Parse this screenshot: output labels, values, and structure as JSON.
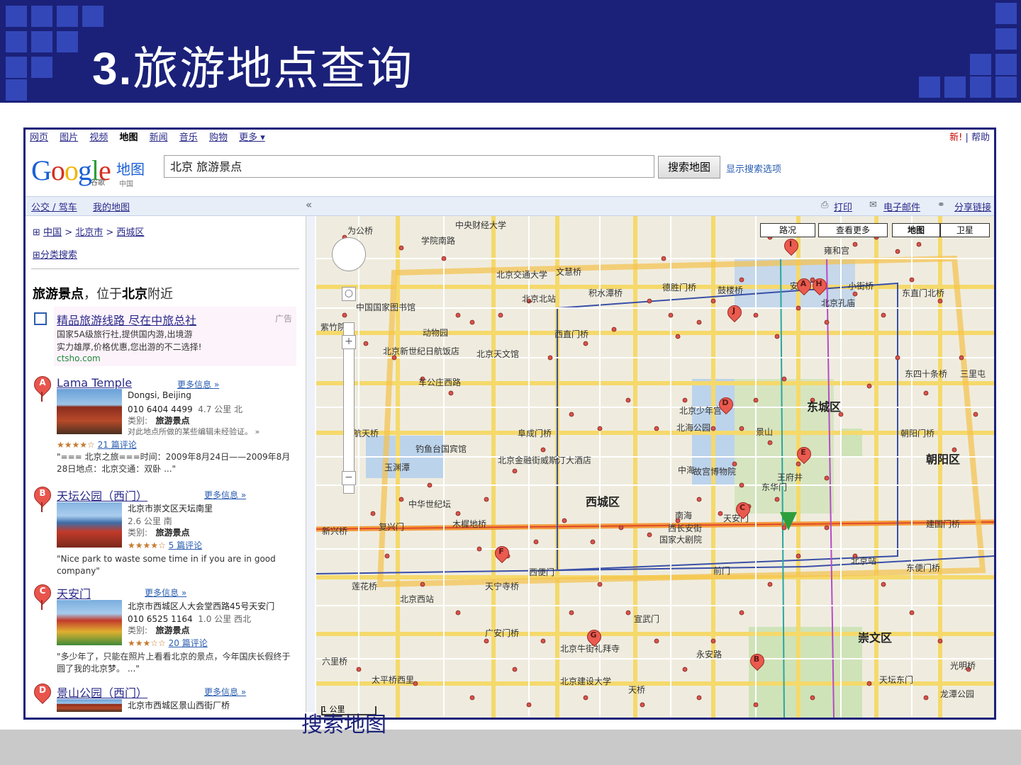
{
  "slide": {
    "title_number": "3.",
    "title_text": "旅游地点查询",
    "caption": "搜索地图"
  },
  "google_nav": {
    "items": [
      "网页",
      "图片",
      "视频",
      "地图",
      "新闻",
      "音乐",
      "购物",
      "更多 ▾"
    ],
    "current": "地图",
    "new_label": "新!",
    "help": "帮助"
  },
  "logo": {
    "text_parts": [
      "G",
      "o",
      "o",
      "g",
      "l",
      "e"
    ],
    "sub": "谷歌",
    "product": "地图",
    "region": "中国"
  },
  "search": {
    "value": "北京 旅游景点",
    "button": "搜索地图",
    "options_link": "显示搜索选项"
  },
  "toolbar": {
    "transit": "公交 / 驾车",
    "my_maps": "我的地图",
    "collapse": "«",
    "print": "打印",
    "email": "电子邮件",
    "share": "分享链接"
  },
  "left": {
    "breadcrumb": [
      "中国",
      "北京市",
      "西城区"
    ],
    "category_search": "分类搜索",
    "heading_pre": "旅游景点",
    "heading_mid": "，位于",
    "heading_loc": "北京",
    "heading_post": "附近"
  },
  "ad": {
    "title": "精品旅游线路 尽在中旅总社",
    "tag": "广告",
    "line1": "国家5A级旅行社,提供国内游,出境游",
    "line2": "实力雄厚,价格优惠,您出游的不二选择!",
    "url": "ctsho.com"
  },
  "results": [
    {
      "letter": "A",
      "name": "Lama Temple",
      "more": "更多信息 »",
      "addr": "Dongsi, Beijing",
      "phone": "010 6404 4499",
      "dist": "4.7 公里 北",
      "category_label": "类别:",
      "category": "旅游景点",
      "note": "对此地点所做的某些编辑未经验证。 »",
      "stars": "★★★★☆",
      "reviews": "21 篇评论",
      "quote": "\"=== 北京之旅===时间：2009年8月24日——2009年8月28日地点：北京交通：双卧 ...\""
    },
    {
      "letter": "B",
      "name": "天坛公园（西门）",
      "more": "更多信息 »",
      "addr": "北京市崇文区天坛南里",
      "phone": "",
      "dist": "2.6 公里 南",
      "category_label": "类别:",
      "category": "旅游景点",
      "note": "",
      "stars": "★★★★☆",
      "reviews": "5 篇评论",
      "quote": "\"Nice park to waste some time in if you are in good company\""
    },
    {
      "letter": "C",
      "name": "天安门",
      "more": "更多信息 »",
      "addr": "北京市西城区人大会堂西路45号天安门",
      "phone": "010 6525 1164",
      "dist": "1.0 公里 西北",
      "category_label": "类别:",
      "category": "旅游景点",
      "note": "",
      "stars": "★★★☆☆",
      "reviews": "20 篇评论",
      "quote": "\"多少年了，只能在照片上看看北京的景点，今年国庆长假终于圆了我的北京梦。 ...\""
    },
    {
      "letter": "D",
      "name": "景山公园（西门）",
      "more": "更多信息 »",
      "addr": "北京市西城区景山西街厂桥",
      "phone": "",
      "dist": "",
      "category_label": "",
      "category": "",
      "note": "",
      "stars": "",
      "reviews": "",
      "quote": ""
    }
  ],
  "map": {
    "types": [
      "路况",
      "查看更多",
      "地图",
      "卫星"
    ],
    "active_type": "地图",
    "scale": "1 公里",
    "labels": [
      "为公桥",
      "中央财经大学",
      "学院南路",
      "文慧桥",
      "北京交通大学",
      "积水潭桥",
      "德胜门桥",
      "鼓楼桥",
      "安定门",
      "小街桥",
      "东直门北桥",
      "北京北站",
      "动物园",
      "西直门桥",
      "中国国家图书馆",
      "紫竹院",
      "北京新世纪日航饭店",
      "北京天文馆",
      "车公庄西路",
      "航天桥",
      "阜成门桥",
      "玉渊潭",
      "钓鱼台国宾馆",
      "北京金融街威斯汀大酒店",
      "西城区",
      "中华世纪坛",
      "木樨地桥",
      "复兴门",
      "西长安街",
      "国家大剧院",
      "天安门",
      "北京西站",
      "天宁寺桥",
      "西便门",
      "莲花桥",
      "广安门桥",
      "北京牛街礼拜寺",
      "北京建设大学",
      "宣武门",
      "东城区",
      "朝阳区",
      "东四十条桥",
      "朝阳门桥",
      "崇文区",
      "龙潭公园",
      "建国门桥",
      "北京站",
      "东便门桥",
      "光明桥",
      "天坛东门",
      "北海公园",
      "景山",
      "故宫博物院",
      "南海",
      "中海",
      "王府井",
      "东华门",
      "北京少年宫",
      "北京孔庙",
      "雍和宫",
      "永安路",
      "天桥",
      "前门",
      "六里桥",
      "太平桥西里",
      "新兴桥",
      "三里屯"
    ],
    "pins": [
      "A",
      "B",
      "C",
      "D",
      "E",
      "F",
      "G",
      "H",
      "I",
      "J"
    ]
  }
}
